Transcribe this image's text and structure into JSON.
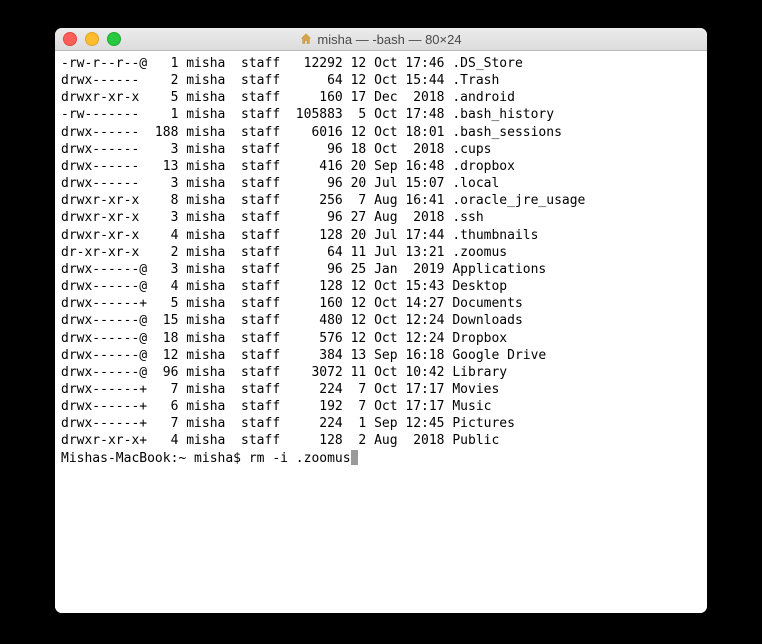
{
  "window": {
    "title": "misha — -bash — 80×24"
  },
  "listing": [
    {
      "perms": "-rw-r--r--@",
      "links": "1",
      "owner": "misha",
      "group": "staff",
      "size": "12292",
      "day": "12",
      "mon": "Oct",
      "time": "17:46",
      "name": ".DS_Store"
    },
    {
      "perms": "drwx------ ",
      "links": "2",
      "owner": "misha",
      "group": "staff",
      "size": "64",
      "day": "12",
      "mon": "Oct",
      "time": "15:44",
      "name": ".Trash"
    },
    {
      "perms": "drwxr-xr-x ",
      "links": "5",
      "owner": "misha",
      "group": "staff",
      "size": "160",
      "day": "17",
      "mon": "Dec",
      "time": " 2018",
      "name": ".android"
    },
    {
      "perms": "-rw------- ",
      "links": "1",
      "owner": "misha",
      "group": "staff",
      "size": "105883",
      "day": " 5",
      "mon": "Oct",
      "time": "17:48",
      "name": ".bash_history"
    },
    {
      "perms": "drwx------ ",
      "links": "188",
      "owner": "misha",
      "group": "staff",
      "size": "6016",
      "day": "12",
      "mon": "Oct",
      "time": "18:01",
      "name": ".bash_sessions"
    },
    {
      "perms": "drwx------ ",
      "links": "3",
      "owner": "misha",
      "group": "staff",
      "size": "96",
      "day": "18",
      "mon": "Oct",
      "time": " 2018",
      "name": ".cups"
    },
    {
      "perms": "drwx------ ",
      "links": "13",
      "owner": "misha",
      "group": "staff",
      "size": "416",
      "day": "20",
      "mon": "Sep",
      "time": "16:48",
      "name": ".dropbox"
    },
    {
      "perms": "drwx------ ",
      "links": "3",
      "owner": "misha",
      "group": "staff",
      "size": "96",
      "day": "20",
      "mon": "Jul",
      "time": "15:07",
      "name": ".local"
    },
    {
      "perms": "drwxr-xr-x ",
      "links": "8",
      "owner": "misha",
      "group": "staff",
      "size": "256",
      "day": " 7",
      "mon": "Aug",
      "time": "16:41",
      "name": ".oracle_jre_usage"
    },
    {
      "perms": "drwxr-xr-x ",
      "links": "3",
      "owner": "misha",
      "group": "staff",
      "size": "96",
      "day": "27",
      "mon": "Aug",
      "time": " 2018",
      "name": ".ssh"
    },
    {
      "perms": "drwxr-xr-x ",
      "links": "4",
      "owner": "misha",
      "group": "staff",
      "size": "128",
      "day": "20",
      "mon": "Jul",
      "time": "17:44",
      "name": ".thumbnails"
    },
    {
      "perms": "dr-xr-xr-x ",
      "links": "2",
      "owner": "misha",
      "group": "staff",
      "size": "64",
      "day": "11",
      "mon": "Jul",
      "time": "13:21",
      "name": ".zoomus"
    },
    {
      "perms": "drwx------@",
      "links": "3",
      "owner": "misha",
      "group": "staff",
      "size": "96",
      "day": "25",
      "mon": "Jan",
      "time": " 2019",
      "name": "Applications"
    },
    {
      "perms": "drwx------@",
      "links": "4",
      "owner": "misha",
      "group": "staff",
      "size": "128",
      "day": "12",
      "mon": "Oct",
      "time": "15:43",
      "name": "Desktop"
    },
    {
      "perms": "drwx------+",
      "links": "5",
      "owner": "misha",
      "group": "staff",
      "size": "160",
      "day": "12",
      "mon": "Oct",
      "time": "14:27",
      "name": "Documents"
    },
    {
      "perms": "drwx------@",
      "links": "15",
      "owner": "misha",
      "group": "staff",
      "size": "480",
      "day": "12",
      "mon": "Oct",
      "time": "12:24",
      "name": "Downloads"
    },
    {
      "perms": "drwx------@",
      "links": "18",
      "owner": "misha",
      "group": "staff",
      "size": "576",
      "day": "12",
      "mon": "Oct",
      "time": "12:24",
      "name": "Dropbox"
    },
    {
      "perms": "drwx------@",
      "links": "12",
      "owner": "misha",
      "group": "staff",
      "size": "384",
      "day": "13",
      "mon": "Sep",
      "time": "16:18",
      "name": "Google Drive"
    },
    {
      "perms": "drwx------@",
      "links": "96",
      "owner": "misha",
      "group": "staff",
      "size": "3072",
      "day": "11",
      "mon": "Oct",
      "time": "10:42",
      "name": "Library"
    },
    {
      "perms": "drwx------+",
      "links": "7",
      "owner": "misha",
      "group": "staff",
      "size": "224",
      "day": " 7",
      "mon": "Oct",
      "time": "17:17",
      "name": "Movies"
    },
    {
      "perms": "drwx------+",
      "links": "6",
      "owner": "misha",
      "group": "staff",
      "size": "192",
      "day": " 7",
      "mon": "Oct",
      "time": "17:17",
      "name": "Music"
    },
    {
      "perms": "drwx------+",
      "links": "7",
      "owner": "misha",
      "group": "staff",
      "size": "224",
      "day": " 1",
      "mon": "Sep",
      "time": "12:45",
      "name": "Pictures"
    },
    {
      "perms": "drwxr-xr-x+",
      "links": "4",
      "owner": "misha",
      "group": "staff",
      "size": "128",
      "day": " 2",
      "mon": "Aug",
      "time": " 2018",
      "name": "Public"
    }
  ],
  "prompt": {
    "host": "Mishas-MacBook",
    "cwd": "~",
    "user": "misha",
    "command": "rm -i .zoomus"
  }
}
